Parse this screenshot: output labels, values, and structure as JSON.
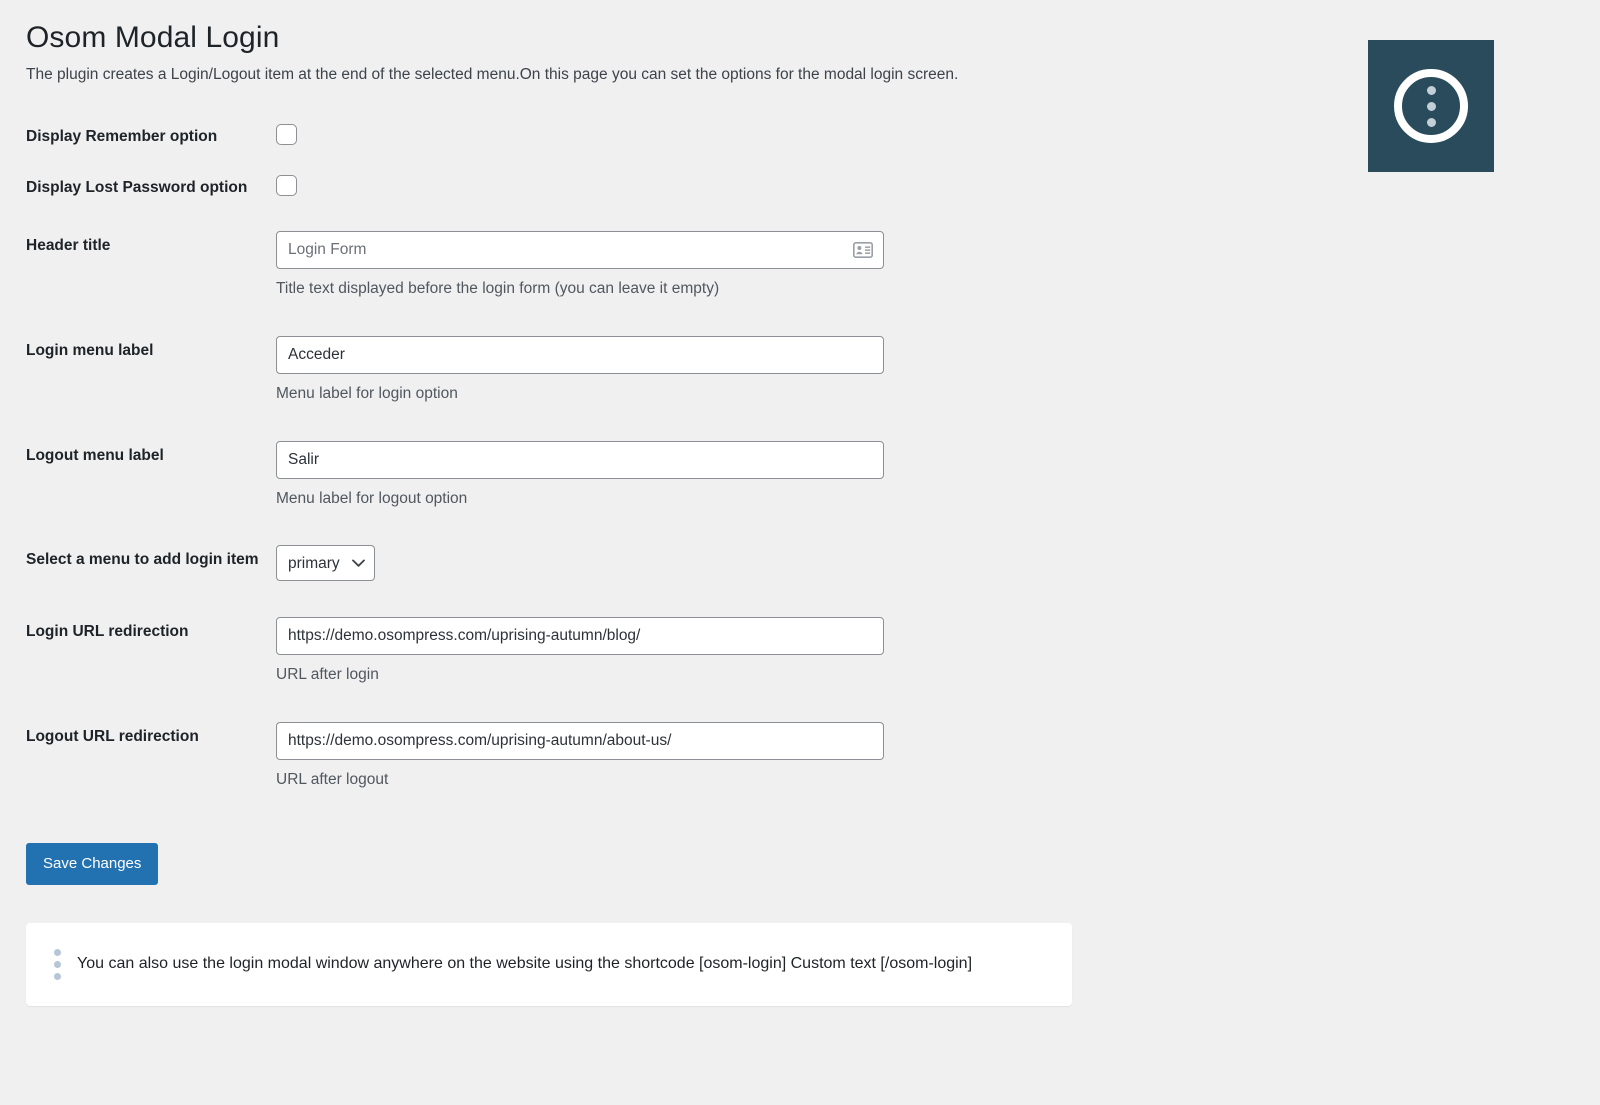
{
  "header": {
    "title": "Osom Modal Login",
    "description": "The plugin creates a Login/Logout item at the end of the selected menu.On this page you can set the options for the modal login screen."
  },
  "logo": {
    "name": "osom-modal-login-logo",
    "background_color": "#2a4b5c",
    "ring_color": "#ffffff",
    "dot_color": "#c3ced6",
    "dot_count": 3
  },
  "fields": {
    "display_remember": {
      "label": "Display Remember option",
      "checked": false
    },
    "display_lost_password": {
      "label": "Display Lost Password option",
      "checked": false
    },
    "header_title": {
      "label": "Header title",
      "value": "",
      "placeholder": "Login Form",
      "help": "Title text displayed before the login form (you can leave it empty)",
      "icon": "contact-card-icon"
    },
    "login_menu_label": {
      "label": "Login menu label",
      "value": "Acceder",
      "help": "Menu label for login option"
    },
    "logout_menu_label": {
      "label": "Logout menu label",
      "value": "Salir",
      "help": "Menu label for logout option"
    },
    "menu_select": {
      "label": "Select a menu to add login item",
      "value": "primary",
      "options": [
        "primary"
      ]
    },
    "login_url": {
      "label": "Login URL redirection",
      "value": "https://demo.osompress.com/uprising-autumn/blog/",
      "help": "URL after login"
    },
    "logout_url": {
      "label": "Logout URL redirection",
      "value": "https://demo.osompress.com/uprising-autumn/about-us/",
      "help": "URL after logout"
    }
  },
  "submit": {
    "label": "Save Changes",
    "color": "#2271b1"
  },
  "notice": {
    "text": "You can also use the login modal window anywhere on the website using the shortcode [osom-login] Custom text [/osom-login]",
    "icon": "vertical-dots-icon"
  }
}
